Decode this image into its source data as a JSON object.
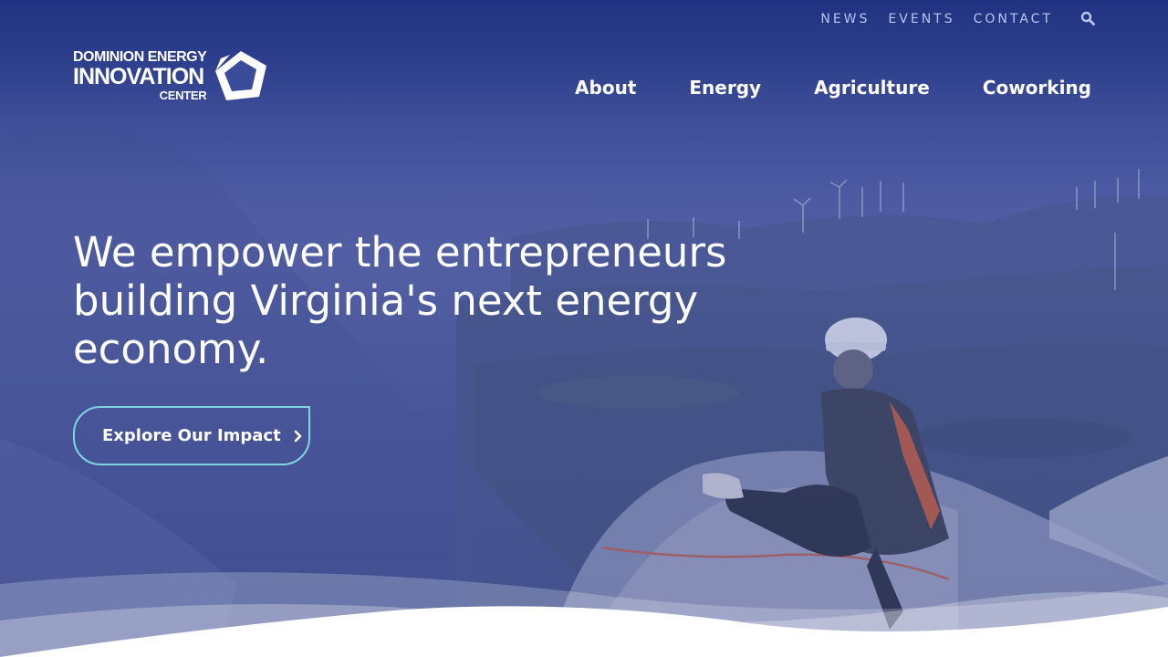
{
  "utility_nav": {
    "items": [
      {
        "label": "NEWS"
      },
      {
        "label": "EVENTS"
      },
      {
        "label": "CONTACT"
      }
    ],
    "search_icon": "search-icon"
  },
  "logo": {
    "line1": "DOMINION ENERGY",
    "line2": "INNOVATION",
    "line3": "CENTER"
  },
  "main_nav": {
    "items": [
      {
        "label": "About"
      },
      {
        "label": "Energy"
      },
      {
        "label": "Agriculture"
      },
      {
        "label": "Coworking"
      }
    ]
  },
  "hero": {
    "headline": "We empower the entrepreneurs building Virginia's next energy economy.",
    "cta_label": "Explore Our Impact",
    "cta_icon": "chevron-right-icon"
  },
  "colors": {
    "brand_blue": "#2b3a8f",
    "cta_border": "#7fd6df",
    "text": "#ffffff",
    "utility_text": "#b9c6ee"
  }
}
